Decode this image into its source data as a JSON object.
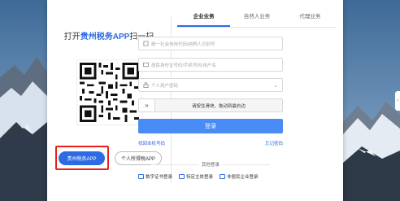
{
  "scan": {
    "prefix": "打开",
    "brand": "贵州税务APP",
    "suffix": "扫一扫"
  },
  "app_buttons": {
    "primary": "贵州税务APP",
    "secondary": "个人所得税APP"
  },
  "tabs": [
    {
      "label": "企业业务",
      "active": true
    },
    {
      "label": "自然人业务",
      "active": false
    },
    {
      "label": "代理业务",
      "active": false
    }
  ],
  "fields": {
    "credit_code": "统一社会信用代码/纳税人识别号",
    "phone": "居民身份证号码/手机号码/用户名",
    "user_type": "个人用户密码"
  },
  "slider": {
    "handle": "»",
    "text": "请按住滑块，拖动到最右边"
  },
  "login_button": "登录",
  "links": {
    "retrieve": "找回本机号码",
    "forgot": "忘记密码"
  },
  "other_title": "其他登录",
  "other_options": [
    "数字证书登录",
    "特定主体登录",
    "非居民企业登录"
  ],
  "colors": {
    "accent": "#2d6be4",
    "login": "#4a8cf5",
    "highlight": "#e8201a"
  }
}
